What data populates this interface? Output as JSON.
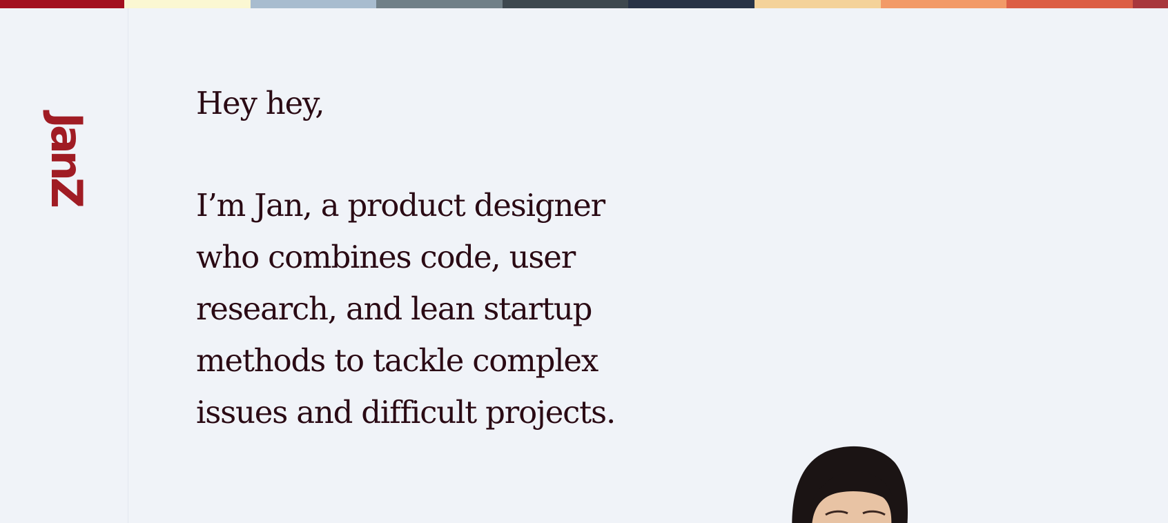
{
  "brand": {
    "logo_text": "JanZ",
    "logo_color": "#a01c24"
  },
  "palette_strip": [
    "#a3101f",
    "#fbf7d2",
    "#a8bccf",
    "#718088",
    "#3e484f",
    "#283347",
    "#f4d29a",
    "#f29a68",
    "#dc5e46",
    "#a8373d"
  ],
  "hero": {
    "greeting": "Hey hey,",
    "intro": "I’m Jan, a product designer who combines code, user research, and lean startup methods to tackle complex issues and difficult projects."
  },
  "colors": {
    "background": "#f0f3f8",
    "text": "#2a0a14"
  },
  "portrait_icon": "person-photo-icon"
}
